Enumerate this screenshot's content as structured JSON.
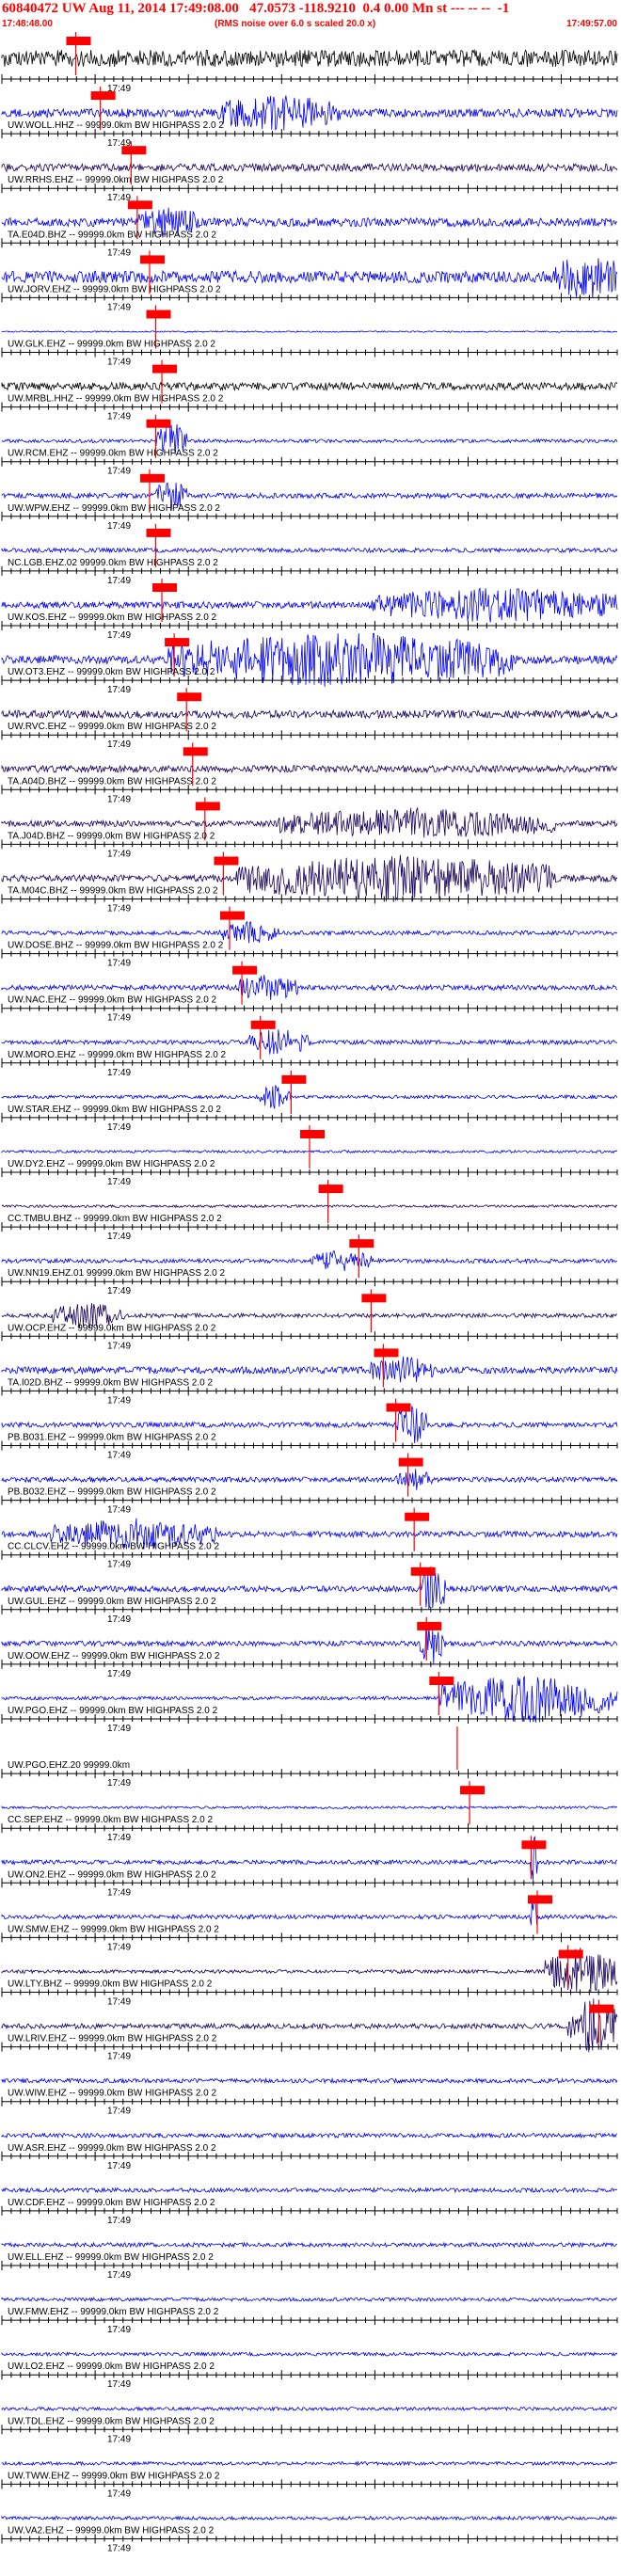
{
  "header": {
    "title": "60840472 UW Aug 11, 2014 17:49:08.00   47.0573 -118.9210  0.4 0.00 Mn st --- -- --  -1",
    "start_time": "17:48:48.00",
    "rms_note": "(RMS noise over 6.0 s scaled 20.0 x)",
    "end_time": "17:49:57.00"
  },
  "chart_data": {
    "type": "line",
    "time_window": [
      "17:48:48.00",
      "17:49:57.00"
    ],
    "tick_label": "17:49",
    "colors": {
      "blue": "#0000ee",
      "black": "#000000",
      "navy": "#16005a",
      "pick": "#ff0000",
      "axis": "#000000"
    },
    "traces": [
      {
        "label": "",
        "color": "black",
        "amp": 1.0,
        "burst": null,
        "pick": 0.12,
        "pick_label": true
      },
      {
        "label": "UW.WOLL.HHZ -- 99999.0km BW  HIGHPASS  2.0  2",
        "color": "blue",
        "amp": 0.5,
        "burst": [
          0.35,
          0.55,
          0.8
        ],
        "pick": 0.16,
        "pick_label": true
      },
      {
        "label": "UW.RRHS.EHZ -- 99999.0km BW  HIGHPASS  2.0  2",
        "color": "navy",
        "amp": 0.45,
        "burst": null,
        "pick": 0.21,
        "pick_label": true
      },
      {
        "label": "TA.E04D.BHZ -- 99999.0km BW  HIGHPASS  2.0  2",
        "color": "blue",
        "amp": 0.5,
        "burst": [
          0.22,
          0.32,
          0.6
        ],
        "pick": 0.22,
        "pick_label": true
      },
      {
        "label": "UW.JORV.EHZ -- 99999.0km BW  HIGHPASS  2.0  2",
        "color": "blue",
        "amp": 0.7,
        "burst": [
          0.9,
          1.0,
          1.0
        ],
        "pick": 0.24,
        "pick_label": true
      },
      {
        "label": "UW.GLK.EHZ -- 99999.0km BW  HIGHPASS  2.0  2",
        "color": "blue",
        "amp": 0.08,
        "burst": null,
        "pick": 0.25,
        "pick_label": true
      },
      {
        "label": "UW.MRBL.HHZ -- 99999.0km BW  HIGHPASS  2.0  2",
        "color": "black",
        "amp": 0.45,
        "burst": null,
        "pick": 0.26,
        "pick_label": true
      },
      {
        "label": "UW.RCM.EHZ -- 99999.0km BW  HIGHPASS  2.0  2",
        "color": "blue",
        "amp": 0.2,
        "burst": [
          0.25,
          0.3,
          1.0
        ],
        "pick": 0.25,
        "pick_label": true
      },
      {
        "label": "UW.WPW.EHZ -- 99999.0km BW  HIGHPASS  2.0  2",
        "color": "blue",
        "amp": 0.3,
        "burst": [
          0.25,
          0.3,
          0.7
        ],
        "pick": 0.24,
        "pick_label": true
      },
      {
        "label": "NC.LGB.EHZ.02 99999.0km BW  HIGHPASS  2.0  2",
        "color": "blue",
        "amp": 0.25,
        "burst": null,
        "pick": 0.25,
        "pick_label": true
      },
      {
        "label": "UW.KOS.EHZ -- 99999.0km BW  HIGHPASS  2.0  2",
        "color": "blue",
        "amp": 0.4,
        "burst": [
          0.6,
          1.0,
          0.8
        ],
        "pick": 0.26,
        "pick_label": true
      },
      {
        "label": "UW.OT3.EHZ -- 99999.0km BW  HIGHPASS  2.0  2",
        "color": "blue",
        "amp": 0.5,
        "burst": [
          0.27,
          0.83,
          1.3
        ],
        "pick": 0.28,
        "pick_label": true
      },
      {
        "label": "UW.RVC.EHZ -- 99999.0km BW  HIGHPASS  2.0  2",
        "color": "navy",
        "amp": 0.45,
        "burst": null,
        "pick": 0.3,
        "pick_label": true
      },
      {
        "label": "TA.A04D.BHZ -- 99999.0km BW  HIGHPASS  2.0  2",
        "color": "navy",
        "amp": 0.4,
        "burst": null,
        "pick": 0.31,
        "pick_label": true
      },
      {
        "label": "TA.J04D.BHZ -- 99999.0km BW  HIGHPASS  2.0  2",
        "color": "navy",
        "amp": 0.35,
        "burst": [
          0.45,
          0.9,
          0.7
        ],
        "pick": 0.33,
        "pick_label": true
      },
      {
        "label": "TA.M04C.BHZ -- 99999.0km BW  HIGHPASS  2.0  2",
        "color": "navy",
        "amp": 0.4,
        "burst": [
          0.38,
          0.9,
          1.1
        ],
        "pick": 0.36,
        "pick_label": true
      },
      {
        "label": "UW.DOSE.BHZ -- 99999.0km BW  HIGHPASS  2.0  2",
        "color": "blue",
        "amp": 0.25,
        "burst": [
          0.35,
          0.45,
          0.5
        ],
        "pick": 0.37,
        "pick_label": true
      },
      {
        "label": "UW.NAC.EHZ -- 99999.0km BW  HIGHPASS  2.0  2",
        "color": "blue",
        "amp": 0.3,
        "burst": [
          0.38,
          0.48,
          0.6
        ],
        "pick": 0.39,
        "pick_label": true
      },
      {
        "label": "UW.MORO.EHZ -- 99999.0km BW  HIGHPASS  2.0  2",
        "color": "blue",
        "amp": 0.25,
        "burst": [
          0.4,
          0.5,
          0.7
        ],
        "pick": 0.42,
        "pick_label": true
      },
      {
        "label": "UW.STAR.EHZ -- 99999.0km BW  HIGHPASS  2.0  2",
        "color": "blue",
        "amp": 0.2,
        "burst": [
          0.42,
          0.47,
          0.6
        ],
        "pick": 0.47,
        "pick_label": true
      },
      {
        "label": "UW.DY2.EHZ -- 99999.0km BW  HIGHPASS  2.0  2",
        "color": "blue",
        "amp": 0.15,
        "burst": null,
        "pick": 0.5,
        "pick_label": true
      },
      {
        "label": "CC.TMBU.BHZ -- 99999.0km BW  HIGHPASS  2.0  2",
        "color": "navy",
        "amp": 0.15,
        "burst": null,
        "pick": 0.53,
        "pick_label": true
      },
      {
        "label": "UW.NN19.EHZ.01 99999.0km BW  HIGHPASS  2.0  2",
        "color": "blue",
        "amp": 0.25,
        "burst": [
          0.5,
          0.6,
          0.5
        ],
        "pick": 0.58,
        "pick_label": true
      },
      {
        "label": "UW.OCP.EHZ -- 99999.0km BW  HIGHPASS  2.0  2",
        "color": "navy",
        "amp": 0.25,
        "burst": [
          0.08,
          0.2,
          0.6
        ],
        "pick": 0.6,
        "pick_label": true
      },
      {
        "label": "TA.I02D.BHZ -- 99999.0km BW  HIGHPASS  2.0  2",
        "color": "blue",
        "amp": 0.4,
        "burst": [
          0.6,
          0.7,
          0.6
        ],
        "pick": 0.62,
        "pick_label": true
      },
      {
        "label": "PB.B031.EHZ -- 99999.0km BW  HIGHPASS  2.0  2",
        "color": "blue",
        "amp": 0.3,
        "burst": [
          0.64,
          0.69,
          1.0
        ],
        "pick": 0.64,
        "pick_label": true
      },
      {
        "label": "PB.B032.EHZ -- 99999.0km BW  HIGHPASS  2.0  2",
        "color": "blue",
        "amp": 0.3,
        "burst": [
          0.64,
          0.7,
          0.5
        ],
        "pick": 0.66,
        "pick_label": true
      },
      {
        "label": "CC.CLCV.EHZ -- 99999.0km BW  HIGHPASS  2.0  2",
        "color": "blue",
        "amp": 0.35,
        "burst": [
          0.08,
          0.35,
          0.7
        ],
        "pick": 0.67,
        "pick_label": true
      },
      {
        "label": "UW.GUL.EHZ -- 99999.0km BW  HIGHPASS  2.0  2",
        "color": "blue",
        "amp": 0.35,
        "burst": [
          0.68,
          0.72,
          1.2
        ],
        "pick": 0.68,
        "pick_label": true
      },
      {
        "label": "UW.OOW.EHZ -- 99999.0km BW  HIGHPASS  2.0  2",
        "color": "blue",
        "amp": 0.3,
        "burst": [
          0.68,
          0.72,
          1.1
        ],
        "pick": 0.69,
        "pick_label": true
      },
      {
        "label": "UW.PGO.EHZ -- 99999.0km BW  HIGHPASS  2.0  2",
        "color": "blue",
        "amp": 0.2,
        "burst": [
          0.71,
          1.0,
          1.3
        ],
        "pick": 0.71,
        "pick_label": true
      },
      {
        "label": "UW.PGO.EHZ.20 99999.0km",
        "color": "blue",
        "amp": 0.0,
        "burst": null,
        "pick": 0.74,
        "pick_label": false
      },
      {
        "label": "CC.SEP.EHZ -- 99999.0km BW  HIGHPASS  2.0  2",
        "color": "blue",
        "amp": 0.15,
        "burst": null,
        "pick": 0.76,
        "pick_label": true
      },
      {
        "label": "UW.ON2.EHZ -- 99999.0km BW  HIGHPASS  2.0  2",
        "color": "blue",
        "amp": 0.25,
        "burst": [
          0.86,
          0.87,
          1.4
        ],
        "pick": 0.86,
        "pick_label": true
      },
      {
        "label": "UW.SMW.EHZ -- 99999.0km BW  HIGHPASS  2.0  2",
        "color": "blue",
        "amp": 0.25,
        "burst": [
          0.86,
          0.87,
          1.4
        ],
        "pick": 0.87,
        "pick_label": true
      },
      {
        "label": "UW.LTY.BHZ -- 99999.0km BW  HIGHPASS  2.0  2",
        "color": "navy",
        "amp": 0.2,
        "burst": [
          0.88,
          1.0,
          1.2
        ],
        "pick": 0.92,
        "pick_label": true
      },
      {
        "label": "UW.LRIV.EHZ -- 99999.0km BW  HIGHPASS  2.0  2",
        "color": "navy",
        "amp": 0.3,
        "burst": [
          0.92,
          1.0,
          1.4
        ],
        "pick": 0.97,
        "pick_label": true
      },
      {
        "label": "UW.WIW.EHZ -- 99999.0km BW  HIGHPASS  2.0  2",
        "color": "blue",
        "amp": 0.25,
        "burst": null,
        "pick": null,
        "pick_label": false
      },
      {
        "label": "UW.ASR.EHZ -- 99999.0km BW  HIGHPASS  2.0  2",
        "color": "blue",
        "amp": 0.25,
        "burst": null,
        "pick": null,
        "pick_label": false
      },
      {
        "label": "UW.CDF.EHZ -- 99999.0km BW  HIGHPASS  2.0  2",
        "color": "blue",
        "amp": 0.25,
        "burst": null,
        "pick": null,
        "pick_label": false
      },
      {
        "label": "UW.ELL.EHZ -- 99999.0km BW  HIGHPASS  2.0  2",
        "color": "blue",
        "amp": 0.25,
        "burst": null,
        "pick": null,
        "pick_label": false
      },
      {
        "label": "UW.FMW.EHZ -- 99999.0km BW  HIGHPASS  2.0  2",
        "color": "blue",
        "amp": 0.2,
        "burst": null,
        "pick": null,
        "pick_label": false
      },
      {
        "label": "UW.LO2.EHZ -- 99999.0km BW  HIGHPASS  2.0  2",
        "color": "blue",
        "amp": 0.2,
        "burst": null,
        "pick": null,
        "pick_label": false
      },
      {
        "label": "UW.TDL.EHZ -- 99999.0km BW  HIGHPASS  2.0  2",
        "color": "blue",
        "amp": 0.2,
        "burst": null,
        "pick": null,
        "pick_label": false
      },
      {
        "label": "UW.TWW.EHZ -- 99999.0km BW  HIGHPASS  2.0  2",
        "color": "blue",
        "amp": 0.2,
        "burst": null,
        "pick": null,
        "pick_label": false
      },
      {
        "label": "UW.VA2.EHZ -- 99999.0km BW  HIGHPASS  2.0  2",
        "color": "blue",
        "amp": 0.2,
        "burst": null,
        "pick": null,
        "pick_label": false
      }
    ]
  }
}
